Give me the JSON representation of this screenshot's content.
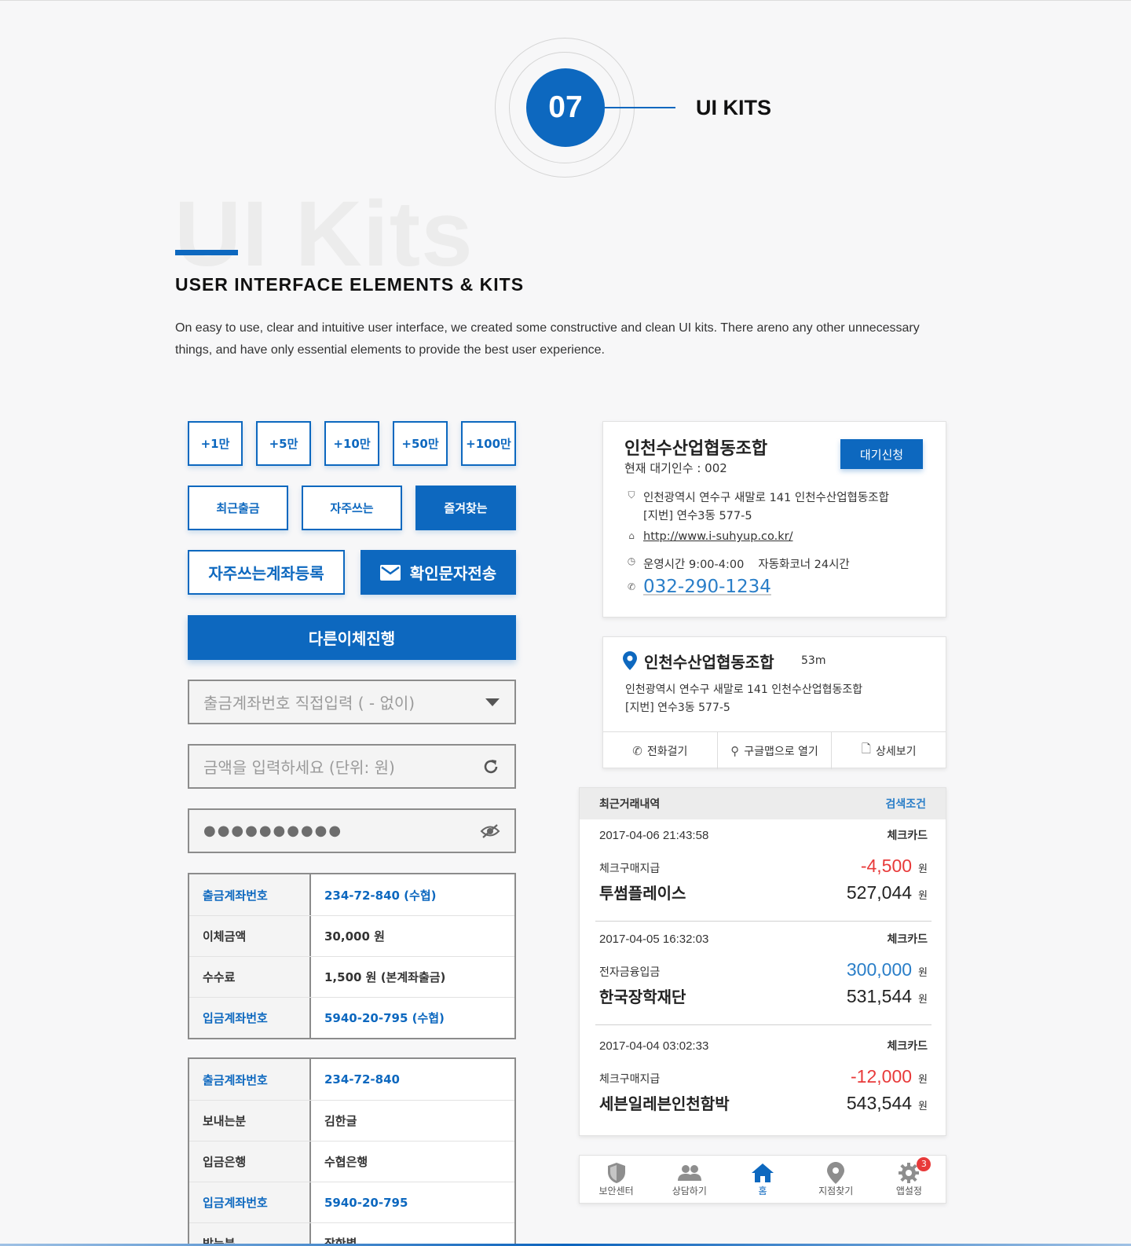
{
  "header": {
    "number": "07",
    "section_title": "UI KITS",
    "ghost_text": "UI Kits",
    "heading": "USER INTERFACE ELEMENTS & KITS",
    "description": "On easy to use, clear and intuitive user interface, we created some constructive and clean UI kits. There areno any other unnecessary things, and have only essential elements to provide the best user experience."
  },
  "amount_buttons": [
    "+1만",
    "+5만",
    "+10만",
    "+50만",
    "+100만"
  ],
  "account_buttons": [
    "최근출금",
    "자주쓰는",
    "즐겨찾는"
  ],
  "register_button": "자주쓰는계좌등록",
  "sms_button": "확인문자전송",
  "proceed_button": "다른이체진행",
  "fields": {
    "account_placeholder": "출금계좌번호 직접입력 ( - 없이)",
    "amount_placeholder": "금액을 입력하세요 (단위: 원)",
    "password_mask": "●●●●●●●●●●"
  },
  "table1": [
    {
      "label": "출금계좌번호",
      "value": "234-72-840 (수협)",
      "blue": true
    },
    {
      "label": "이체금액",
      "value": "30,000 원",
      "blue": false
    },
    {
      "label": "수수료",
      "value": "1,500 원 (본계좌출금)",
      "blue": false
    },
    {
      "label": "입금계좌번호",
      "value": "5940-20-795 (수협)",
      "blue": true
    }
  ],
  "table2": [
    {
      "label": "출금계좌번호",
      "value": "234-72-840",
      "blue": true
    },
    {
      "label": "보내는분",
      "value": "김한글",
      "blue": false
    },
    {
      "label": "입금은행",
      "value": "수협은행",
      "blue": false
    },
    {
      "label": "입금계좌번호",
      "value": "5940-20-795",
      "blue": true
    },
    {
      "label": "받는분",
      "value": "장한별",
      "blue": false
    }
  ],
  "branch_card": {
    "name": "인천수산업협동조합",
    "waiting": "현재 대기인수 : 002",
    "apply_button": "대기신청",
    "address1": "인천광역시 연수구 새말로 141 인천수산업협동조합",
    "address2": "[지번] 연수3동 577-5",
    "url": "http://www.i-suhyup.co.kr/",
    "hours": "운영시간 9:00-4:00",
    "atm_hours": "자동화코너 24시간",
    "phone": "032-290-1234"
  },
  "location_card": {
    "name": "인천수산업협동조합",
    "distance": "53m",
    "address1": "인천광역시 연수구 새말로 141 인천수산업협동조합",
    "address2": "[지번] 연수3동 577-5",
    "actions": [
      "전화걸기",
      "구글맵으로 열기",
      "상세보기"
    ]
  },
  "transactions": {
    "title": "최근거래내역",
    "search": "검색조건",
    "currency": "원",
    "items": [
      {
        "date": "2017-04-06 21:43:58",
        "card": "체크카드",
        "type": "체크구매지급",
        "merchant": "투썸플레이스",
        "amount": "-4,500",
        "balance": "527,044"
      },
      {
        "date": "2017-04-05 16:32:03",
        "card": "체크카드",
        "type": "전자금융입금",
        "merchant": "한국장학재단",
        "amount": "300,000",
        "balance": "531,544"
      },
      {
        "date": "2017-04-04 03:02:33",
        "card": "체크카드",
        "type": "체크구매지급",
        "merchant": "세븐일레븐인천함박",
        "amount": "-12,000",
        "balance": "543,544"
      }
    ]
  },
  "tabbar": {
    "items": [
      "보안센터",
      "상담하기",
      "홈",
      "지점찾기",
      "앱설정"
    ],
    "badge": "3",
    "active": "홈"
  },
  "colors": {
    "primary": "#0d68bf",
    "negative": "#e83a3a",
    "positive": "#2a7ec8"
  }
}
